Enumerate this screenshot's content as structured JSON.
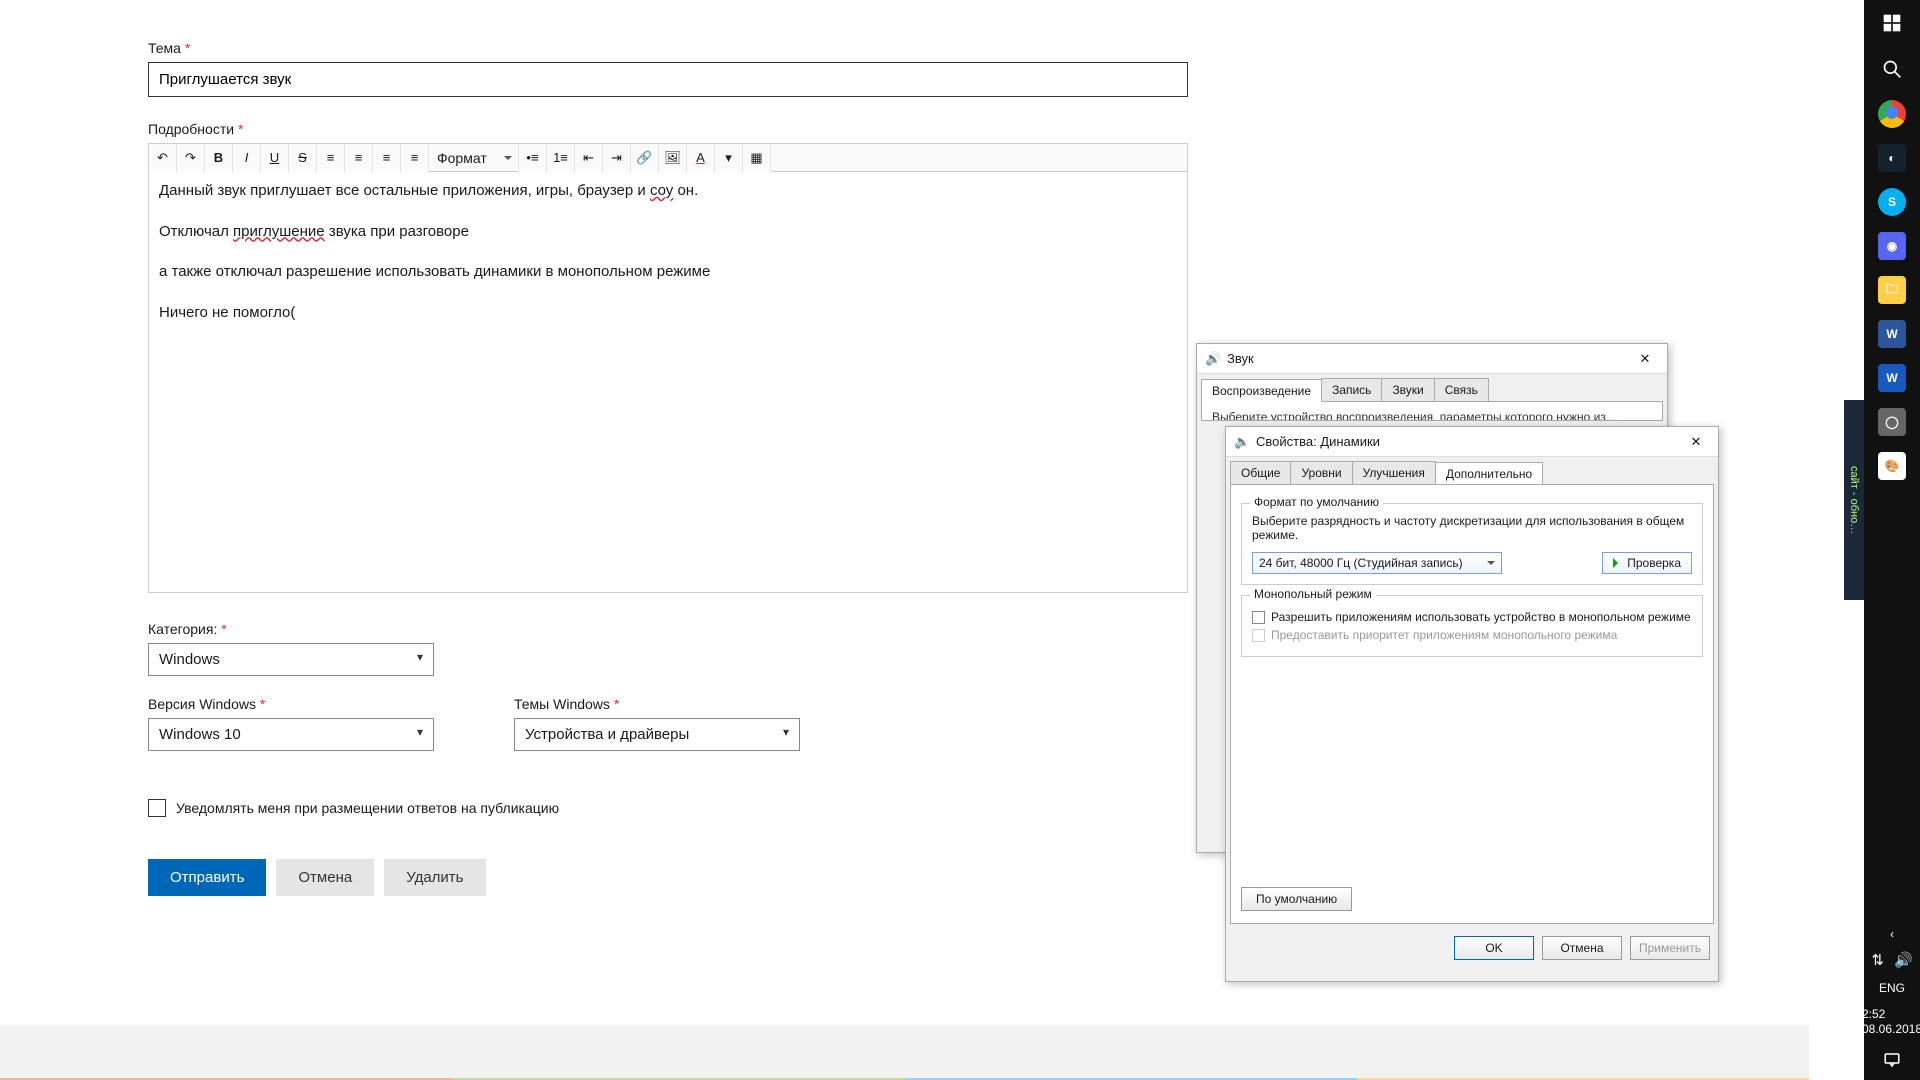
{
  "form": {
    "topic_label": "Тема",
    "topic_value": "Приглушается звук",
    "details_label": "Подробности",
    "format_label": "Формат",
    "details_html": {
      "p1_a": "Данный звук приглушает все остальные приложения, игры, браузер и ",
      "p1_u": "соу",
      "p1_b": " он.",
      "p2_a": "Отключал ",
      "p2_u": "приглушение",
      "p2_b": " звука при разговоре",
      "p3": "а также отключал разрешение использовать динамики в монопольном режиме",
      "p4": "Ничего не помогло("
    },
    "category_label": "Категория:",
    "category_value": "Windows",
    "version_label": "Версия Windows",
    "version_value": "Windows 10",
    "theme_label": "Темы Windows",
    "theme_value": "Устройства и драйверы",
    "notify_label": "Уведомлять меня при размещении ответов на публикацию",
    "submit": "Отправить",
    "cancel": "Отмена",
    "delete": "Удалить"
  },
  "sound_dialog": {
    "title": "Звук",
    "tabs": [
      "Воспроизведение",
      "Запись",
      "Звуки",
      "Связь"
    ],
    "note": "Выберите устройство воспроизведения, параметры которого нужно из…"
  },
  "props_dialog": {
    "title": "Свойства: Динамики",
    "tabs": [
      "Общие",
      "Уровни",
      "Улучшения",
      "Дополнительно"
    ],
    "group_format": "Формат по умолчанию",
    "format_desc": "Выберите разрядность и частоту дискретизации для использования в общем режиме.",
    "combo_value": "24 бит, 48000 Гц (Студийная запись)",
    "test": "Проверка",
    "group_excl": "Монопольный режим",
    "chk1": "Разрешить приложениям использовать устройство в монопольном режиме",
    "chk2": "Предоставить приоритет приложениям монопольного режима",
    "defaults": "По умолчанию",
    "ok": "OK",
    "cancel": "Отмена",
    "apply": "Применить"
  },
  "taskbar": {
    "lang": "ENG",
    "time": "2:52",
    "date": "08.06.2018",
    "side_label": "сайт - обно…"
  }
}
